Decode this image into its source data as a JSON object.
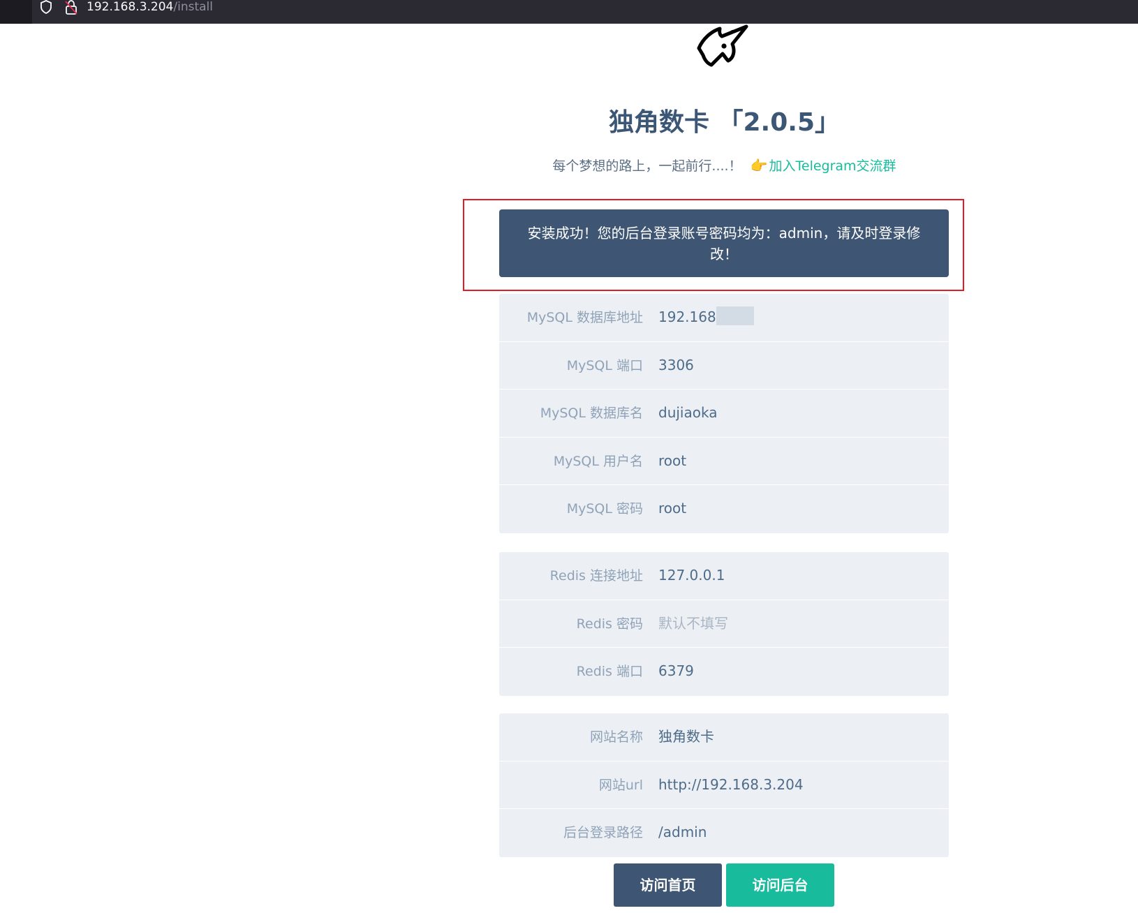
{
  "browser": {
    "url_host": "192.168.3.204",
    "url_path": "/install"
  },
  "header": {
    "title": "独角数卡 「2.0.5」",
    "subtitle": "每个梦想的路上，一起前行....！",
    "hand_glyph": "👉",
    "telegram_link": "加入Telegram交流群"
  },
  "alert": {
    "message": "安装成功！您的后台登录账号密码均为：admin，请及时登录修改！"
  },
  "mysql": {
    "rows": [
      {
        "label": "MySQL 数据库地址",
        "value": "192.168"
      },
      {
        "label": "MySQL 端口",
        "value": "3306"
      },
      {
        "label": "MySQL 数据库名",
        "value": "dujiaoka"
      },
      {
        "label": "MySQL 用户名",
        "value": "root"
      },
      {
        "label": "MySQL 密码",
        "value": "root"
      }
    ]
  },
  "redis": {
    "rows": [
      {
        "label": "Redis 连接地址",
        "value": "127.0.0.1"
      },
      {
        "label": "Redis 密码",
        "placeholder": "默认不填写"
      },
      {
        "label": "Redis 端口",
        "value": "6379"
      }
    ]
  },
  "site": {
    "rows": [
      {
        "label": "网站名称",
        "value": "独角数卡"
      },
      {
        "label": "网站url",
        "value": "http://192.168.3.204"
      },
      {
        "label": "后台登录路径",
        "value": "/admin"
      }
    ]
  },
  "buttons": {
    "home": "访问首页",
    "admin": "访问后台"
  },
  "colors": {
    "primary": "#3e5673",
    "accent": "#18bc9c",
    "panel_bg": "#ecf0f5",
    "highlight": "#e31b23"
  },
  "icons": {
    "shield": "shield-icon",
    "lock": "lock-slash-icon",
    "logo": "unicorn-logo-icon",
    "hand": "pointing-hand-icon"
  }
}
